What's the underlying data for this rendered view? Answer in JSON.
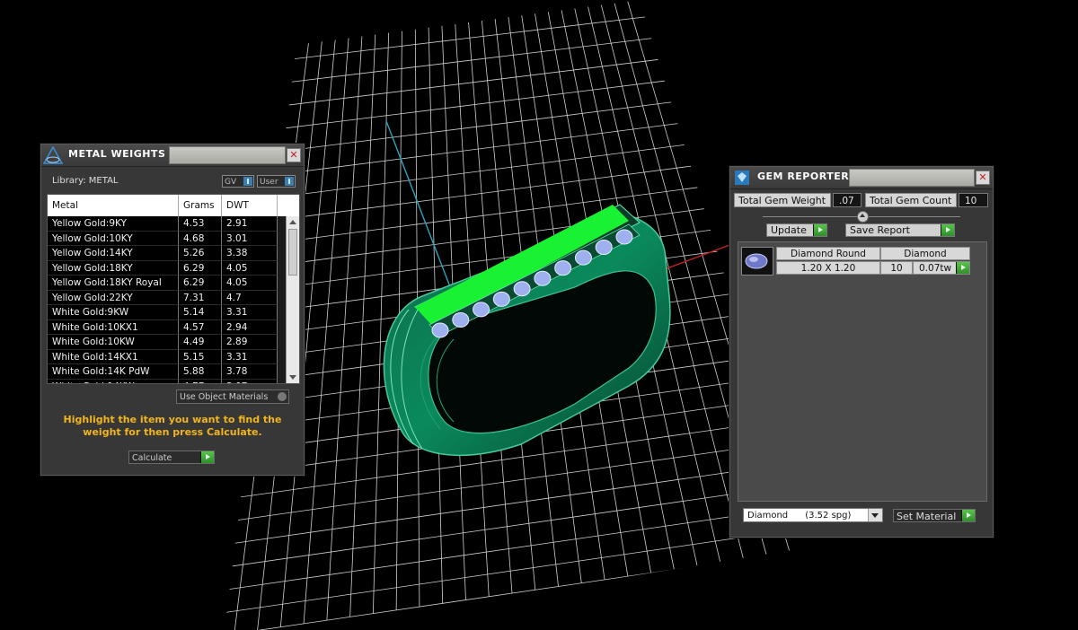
{
  "metal_weights": {
    "title": "METAL WEIGHTS",
    "library_label": "Library: METAL",
    "toggle_gv": "GV",
    "toggle_user": "User",
    "columns": [
      "Metal",
      "Grams",
      "DWT"
    ],
    "rows": [
      [
        "Yellow Gold:9KY",
        "4.53",
        "2.91"
      ],
      [
        "Yellow Gold:10KY",
        "4.68",
        "3.01"
      ],
      [
        "Yellow Gold:14KY",
        "5.26",
        "3.38"
      ],
      [
        "Yellow Gold:18KY",
        "6.29",
        "4.05"
      ],
      [
        "Yellow Gold:18KY Royal",
        "6.29",
        "4.05"
      ],
      [
        "Yellow Gold:22KY",
        "7.31",
        "4.7"
      ],
      [
        "White Gold:9KW",
        "5.14",
        "3.31"
      ],
      [
        "White Gold:10KX1",
        "4.57",
        "2.94"
      ],
      [
        "White Gold:10KW",
        "4.49",
        "2.89"
      ],
      [
        "White Gold:14KX1",
        "5.15",
        "3.31"
      ],
      [
        "White Gold:14K PdW",
        "5.88",
        "3.78"
      ]
    ],
    "use_object_materials": "Use Object Materials",
    "hint": "Highlight the item you want to find the weight for then press Calculate.",
    "calculate_label": "Calculate"
  },
  "gem_reporter": {
    "title": "GEM REPORTER",
    "total_weight_label": "Total Gem Weight",
    "total_weight_value": ".07",
    "total_count_label": "Total Gem Count",
    "total_count_value": "10",
    "update_label": "Update",
    "save_report_label": "Save Report",
    "gems": [
      {
        "shape": "Diamond Round",
        "size": "1.20 X 1.20",
        "material": "Diamond",
        "count": "10",
        "weight": "0.07tw"
      }
    ],
    "material_select": "Diamond      (3.52 spg)",
    "set_material_label": "Set Material"
  },
  "colors": {
    "grid": "#d0d0d0",
    "ring": "#0b7a55",
    "ring_edge": "#49c89a",
    "highlight": "#19f232",
    "title_hint": "#f2b51a",
    "play_button": "#3fae36"
  }
}
